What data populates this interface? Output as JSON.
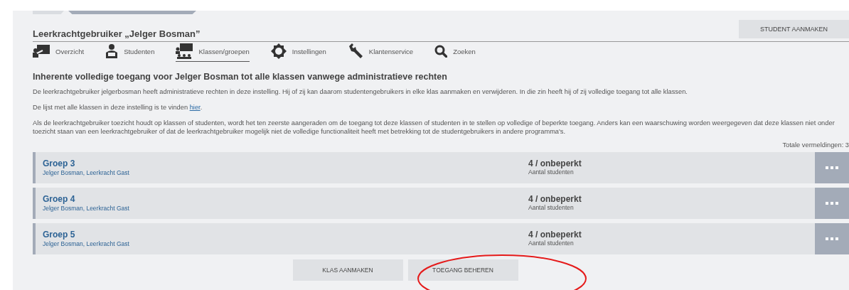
{
  "header": {
    "title": "Leerkrachtgebruiker „Jelger Bosman”",
    "action": "STUDENT AANMAKEN"
  },
  "nav": [
    {
      "kind": "overview",
      "label": "Overzicht",
      "selected": false
    },
    {
      "kind": "students",
      "label": "Studenten",
      "selected": false
    },
    {
      "kind": "classes",
      "label": "Klassen/groepen",
      "selected": true
    },
    {
      "kind": "settings",
      "label": "Instellingen",
      "selected": false
    },
    {
      "kind": "support",
      "label": "Klantenservice",
      "selected": false
    },
    {
      "kind": "search",
      "label": "Zoeken",
      "selected": false
    }
  ],
  "heading": "Inherente volledige toegang voor Jelger Bosman tot alle klassen vanwege administratieve rechten",
  "paragraph_1": "De leerkrachtgebruiker jelgerbosman heeft administratieve rechten in deze instelling. Hij of zij kan daarom studentengebruikers in elke klas aanmaken en verwijderen. In die zin heeft hij of zij volledige toegang tot alle klassen.",
  "paragraph_2": {
    "text": "De lijst met alle klassen in deze instelling is te vinden ",
    "link": "hier",
    "end": "."
  },
  "paragraph_3": "Als de leerkrachtgebruiker toezicht houdt op klassen of studenten, wordt het ten zeerste aangeraden om de toegang tot deze klassen of studenten in te stellen op volledige of beperkte toegang. Anders kan een waarschuwing worden weergegeven dat deze klassen niet onder toezicht staan van een leerkrachtgebruiker of dat de leerkrachtgebruiker mogelijk niet de volledige functionaliteit heeft met betrekking tot de studentgebruikers in andere programma's.",
  "total": "Totale vermeldingen: 3",
  "classes": [
    {
      "name": "Groep 3",
      "teachers": "Jelger Bosman, Leerkracht Gast",
      "count": "4 / onbeperkt",
      "count_label": "Aantal studenten"
    },
    {
      "name": "Groep 4",
      "teachers": "Jelger Bosman, Leerkracht Gast",
      "count": "4 / onbeperkt",
      "count_label": "Aantal studenten"
    },
    {
      "name": "Groep 5",
      "teachers": "Jelger Bosman, Leerkracht Gast",
      "count": "4 / onbeperkt",
      "count_label": "Aantal studenten"
    }
  ],
  "buttons": [
    "KLAS AANMAKEN",
    "TOEGANG BEHEREN"
  ]
}
